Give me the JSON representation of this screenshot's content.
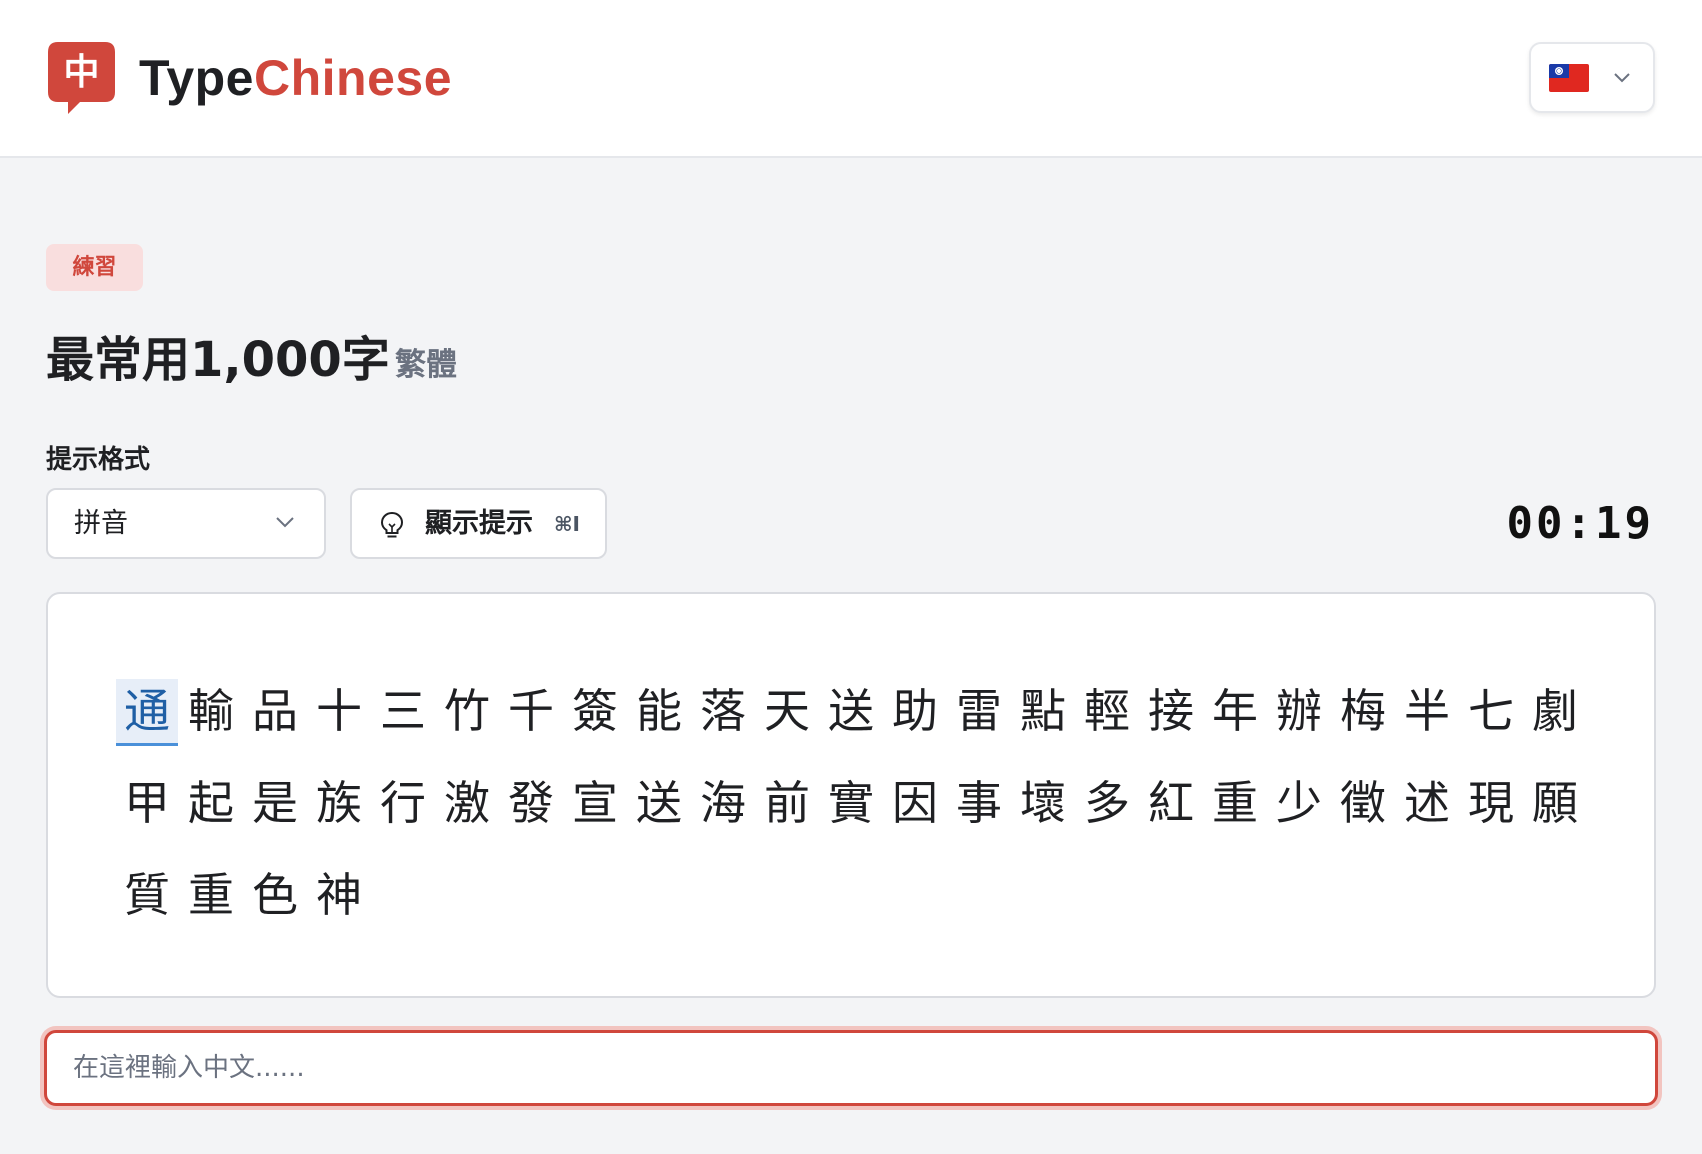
{
  "header": {
    "logo_char": "中",
    "brand_part1": "Type",
    "brand_part2": "Chinese",
    "language_flag": "taiwan-flag"
  },
  "badge": "練習",
  "title": "最常用1,000字",
  "subtitle": "繁體",
  "hint_format_label": "提示格式",
  "format_select_value": "拼音",
  "hint_button_label": "顯示提示",
  "hint_shortcut": "⌘I",
  "timer": "00:19",
  "characters": [
    "通",
    "輸",
    "品",
    "十",
    "三",
    "竹",
    "千",
    "簽",
    "能",
    "落",
    "天",
    "送",
    "助",
    "雷",
    "點",
    "輕",
    "接",
    "年",
    "辦",
    "梅",
    "半",
    "七",
    "劇",
    "甲",
    "起",
    "是",
    "族",
    "行",
    "激",
    "發",
    "宣",
    "送",
    "海",
    "前",
    "實",
    "因",
    "事",
    "壞",
    "多",
    "紅",
    "重",
    "少",
    "徵",
    "述",
    "現",
    "願",
    "質",
    "重",
    "色",
    "神"
  ],
  "current_index": 0,
  "input_placeholder": "在這裡輸入中文......",
  "colors": {
    "accent": "#d0473c",
    "badge_bg": "#f9dede",
    "current_char_bg": "#e7eef8",
    "current_char_underline": "#4a90d9"
  }
}
